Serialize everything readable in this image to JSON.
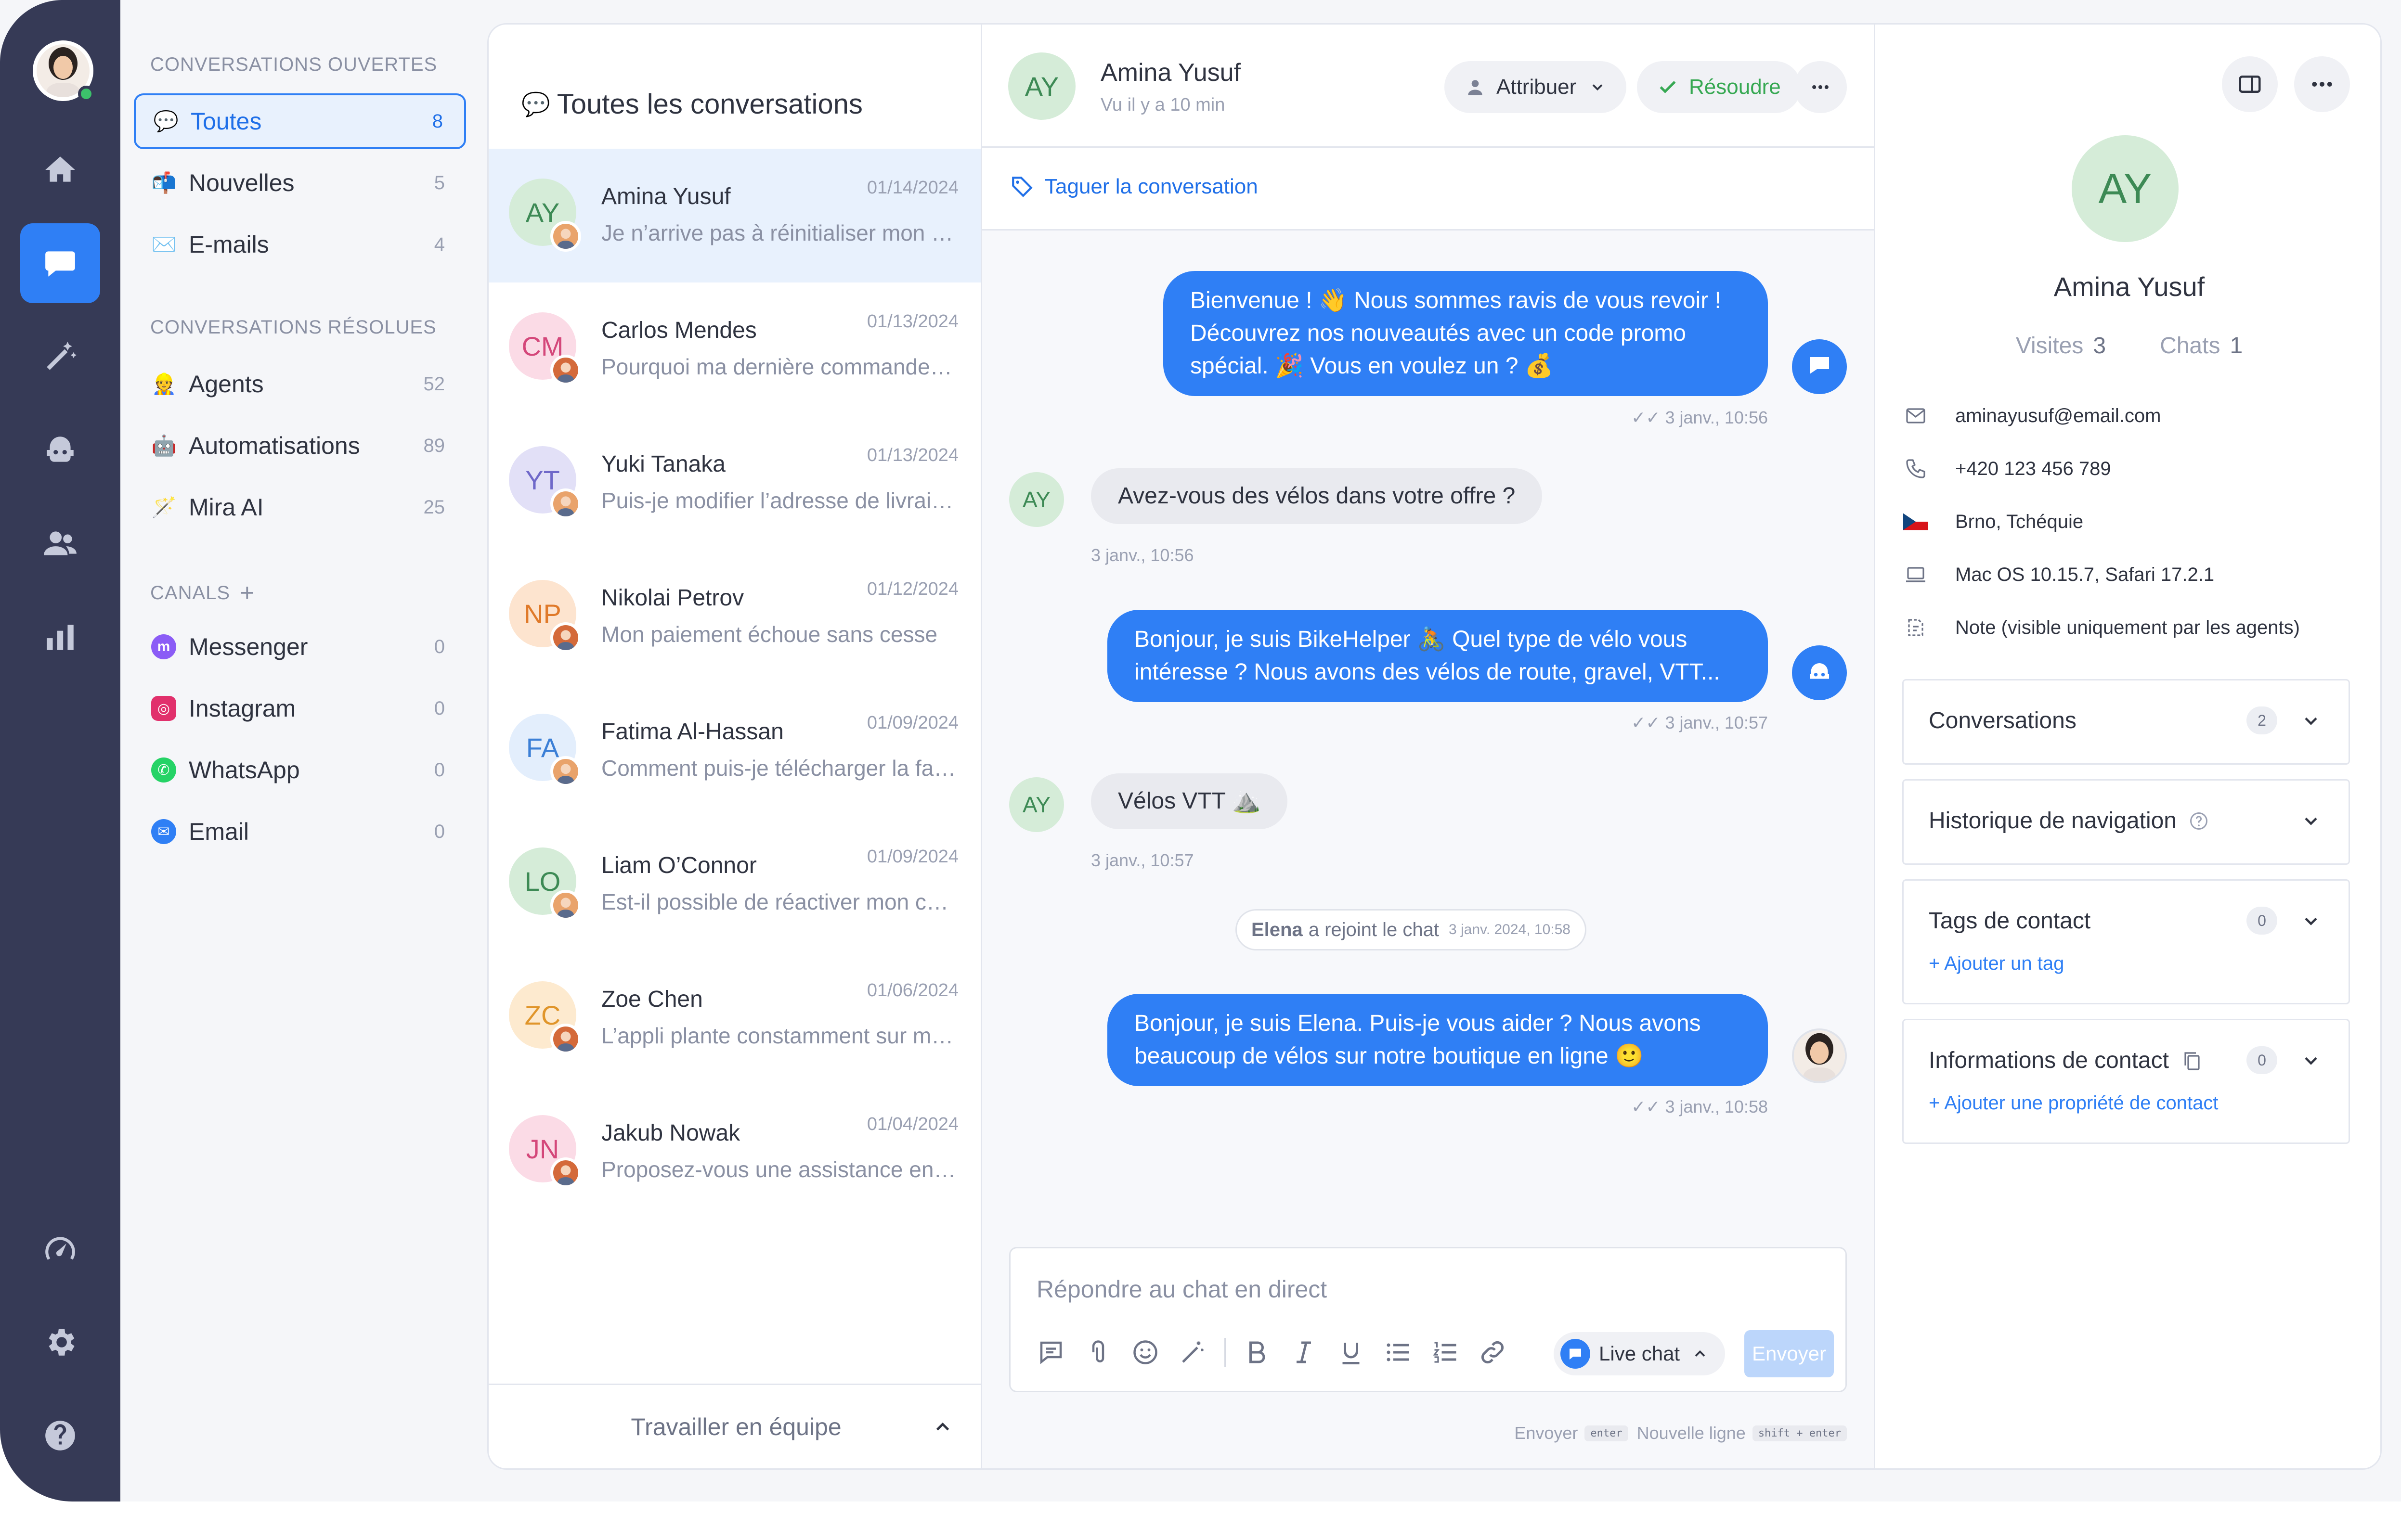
{
  "sidebar": {
    "open_header": "CONVERSATIONS OUVERTES",
    "open": [
      {
        "label": "Toutes",
        "count": "8",
        "emoji": "💬"
      },
      {
        "label": "Nouvelles",
        "count": "5",
        "emoji": "📬"
      },
      {
        "label": "E-mails",
        "count": "4",
        "emoji": "✉️"
      }
    ],
    "resolved_header": "CONVERSATIONS RÉSOLUES",
    "resolved": [
      {
        "label": "Agents",
        "count": "52",
        "emoji": "👷"
      },
      {
        "label": "Automatisations",
        "count": "89",
        "emoji": "🤖"
      },
      {
        "label": "Mira AI",
        "count": "25",
        "emoji": "🪄"
      }
    ],
    "channels_header": "CANALS",
    "channels_add": "+",
    "channels": [
      {
        "label": "Messenger",
        "count": "0",
        "color": "#8b5cf6",
        "glyph": "m"
      },
      {
        "label": "Instagram",
        "count": "0",
        "color": "#e1306c",
        "glyph": "◎"
      },
      {
        "label": "WhatsApp",
        "count": "0",
        "color": "#25d366",
        "glyph": "✆"
      },
      {
        "label": "Email",
        "count": "0",
        "color": "#2f7ff5",
        "glyph": "✉"
      }
    ]
  },
  "convlist": {
    "title": "Toutes les conversations",
    "footer": "Travailler en équipe",
    "items": [
      {
        "initials": "AY",
        "name": "Amina Yusuf",
        "date": "01/14/2024",
        "preview": "Je n’arrive pas à réinitialiser mon mot de passe",
        "bg": "#d5ecd8",
        "fg": "#3d8a55",
        "agent": "#e9a36b"
      },
      {
        "initials": "CM",
        "name": "Carlos Mendes",
        "date": "01/13/2024",
        "preview": "Pourquoi ma dernière commande n’est pas arrivée",
        "bg": "#fbdbe6",
        "fg": "#d4477a",
        "agent": "#d46a3a"
      },
      {
        "initials": "YT",
        "name": "Yuki Tanaka",
        "date": "01/13/2024",
        "preview": "Puis-je modifier l’adresse de livraison",
        "bg": "#e2e0f7",
        "fg": "#6f68c9",
        "agent": "#e9a36b"
      },
      {
        "initials": "NP",
        "name": "Nikolai Petrov",
        "date": "01/12/2024",
        "preview": "Mon paiement échoue sans cesse",
        "bg": "#fde4cf",
        "fg": "#e07a2a",
        "agent": "#d46a3a"
      },
      {
        "initials": "FA",
        "name": "Fatima Al-Hassan",
        "date": "01/09/2024",
        "preview": "Comment puis-je télécharger la facture",
        "bg": "#e3eefc",
        "fg": "#3b7fd6",
        "agent": "#e9a36b"
      },
      {
        "initials": "LO",
        "name": "Liam O’Connor",
        "date": "01/09/2024",
        "preview": "Est-il possible de réactiver mon compte",
        "bg": "#d5ecd8",
        "fg": "#3d8a55",
        "agent": "#e9a36b"
      },
      {
        "initials": "ZC",
        "name": "Zoe Chen",
        "date": "01/06/2024",
        "preview": "L’appli plante constamment sur mon téléphone",
        "bg": "#fdeacf",
        "fg": "#e0952a",
        "agent": "#d46a3a"
      },
      {
        "initials": "JN",
        "name": "Jakub Nowak",
        "date": "01/04/2024",
        "preview": "Proposez-vous une assistance en français",
        "bg": "#fbdbe6",
        "fg": "#d4477a",
        "agent": "#d46a3a"
      }
    ]
  },
  "chat": {
    "contact_initials": "AY",
    "contact_name": "Amina Yusuf",
    "last_seen": "Vu il y a 10 min",
    "assign_label": "Attribuer",
    "resolve_label": "Résoudre",
    "tag_label": "Taguer la conversation",
    "messages": {
      "m1_line1": "Bienvenue ! 👋 Nous sommes ravis de vous revoir !",
      "m1_line2": "Découvrez nos nouveautés avec un code promo",
      "m1_line3": "spécial. 🎉 Vous en voulez un ? 💰",
      "m1_time": "3 janv., 10:56",
      "m2_text": "Avez-vous des vélos dans votre offre ?",
      "m2_time": "3 janv., 10:56",
      "m3_line1": "Bonjour, je suis BikeHelper 🚴 Quel type de vélo vous",
      "m3_line2": "intéresse ? Nous avons des vélos de route, gravel, VTT...",
      "m3_time": "3 janv., 10:57",
      "m4_text": "Vélos VTT ⛰️",
      "m4_time": "3 janv., 10:57",
      "join_name": "Elena",
      "join_text": "a rejoint le chat",
      "join_time": "3 janv. 2024, 10:58",
      "m5_line1": "Bonjour, je suis Elena. Puis-je vous aider ? Nous avons",
      "m5_line2": "beaucoup de vélos sur notre boutique en ligne 🙂",
      "m5_time": "3 janv., 10:58"
    },
    "composer_placeholder": "Répondre au chat en direct",
    "channel_label": "Live chat",
    "send_label": "Envoyer",
    "hint_send": "Envoyer",
    "hint_send_key": "enter",
    "hint_newline": "Nouvelle ligne",
    "hint_newline_key": "shift + enter"
  },
  "contact": {
    "initials": "AY",
    "name": "Amina Yusuf",
    "visits_label": "Visites",
    "visits": "3",
    "chats_label": "Chats",
    "chats": "1",
    "email": "aminayusuf@email.com",
    "phone": "+420 123 456 789",
    "location": "Brno, Tchéquie",
    "device": "Mac OS 10.15.7, Safari 17.2.1",
    "note": "Note (visible uniquement par les agents)",
    "cards": {
      "conversations": "Conversations",
      "conversations_count": "2",
      "history": "Historique de navigation",
      "tags": "Tags de contact",
      "tags_count": "0",
      "tags_link": "+ Ajouter un tag",
      "info": "Informations de contact",
      "info_count": "0",
      "info_link": "+ Ajouter une propriété de contact"
    }
  },
  "colors": {
    "accent": "#2f7ff5",
    "rail": "#363a56",
    "resolve": "#36a852"
  }
}
